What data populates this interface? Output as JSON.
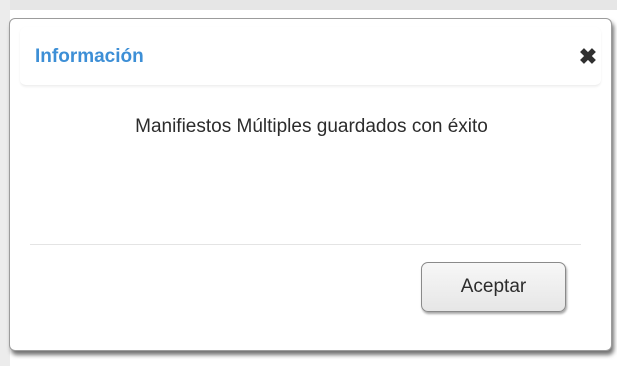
{
  "dialog": {
    "title": "Información",
    "close_glyph": "✖",
    "message": "Manifiestos Múltiples guardados con éxito",
    "accept_label": "Aceptar"
  },
  "icons": {
    "close": "close-icon"
  },
  "colors": {
    "title": "#3d8fd6",
    "text": "#2c2c2c",
    "button_border": "#8a8a8a"
  }
}
